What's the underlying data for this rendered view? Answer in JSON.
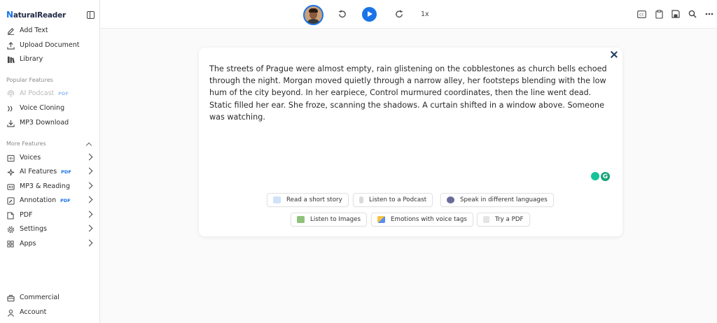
{
  "app": {
    "logo_text": "aturalReader",
    "logo_initial": "N"
  },
  "sidebar": {
    "top_items": [
      {
        "label": "Add Text",
        "icon": "edit-icon"
      },
      {
        "label": "Upload Document",
        "icon": "upload-icon"
      },
      {
        "label": "Library",
        "icon": "library-icon"
      }
    ],
    "popular_label": "Popular Features",
    "popular_items": [
      {
        "label": "AI Podcast",
        "badge": "PDF",
        "icon": "podcast-icon",
        "disabled": true
      },
      {
        "label": "Voice Cloning",
        "icon": "voice-cloning-icon"
      },
      {
        "label": "MP3 Download",
        "icon": "download-icon"
      }
    ],
    "more_label": "More Features",
    "more_items": [
      {
        "label": "Voices",
        "icon": "voices-icon"
      },
      {
        "label": "AI Features",
        "badge": "PDF",
        "icon": "ai-icon"
      },
      {
        "label": "MP3 & Reading",
        "icon": "mp3-reading-icon"
      },
      {
        "label": "Annotation",
        "badge": "PDF",
        "icon": "annotation-icon"
      },
      {
        "label": "PDF",
        "icon": "pdf-icon"
      },
      {
        "label": "Settings",
        "icon": "gear-icon"
      },
      {
        "label": "Apps",
        "icon": "apps-icon"
      }
    ],
    "bottom_items": [
      {
        "label": "Commercial",
        "icon": "briefcase-icon"
      },
      {
        "label": "Account",
        "icon": "user-icon"
      }
    ]
  },
  "toolbar": {
    "speed": "1x",
    "right_icons": [
      "captions-icon",
      "clipboard-icon",
      "save-icon",
      "search-icon",
      "more-icon"
    ]
  },
  "editor": {
    "text": "The streets of Prague were almost empty, rain glistening on the cobblestones as church bells echoed through the night. Morgan moved quietly through a narrow alley, her footsteps blending with the low hum of the city beyond. In her earpiece, Control murmured coordinates, then the line went dead. Static filled her ear. She froze, scanning the shadows. A curtain shifted in a window above. Someone was watching.",
    "suggestions_row1": [
      {
        "label": "Read a short story",
        "icon": "book-icon"
      },
      {
        "label": "Listen to a Podcast",
        "icon": "microphone-icon"
      },
      {
        "label": "Speak in different languages",
        "icon": "speech-icon"
      }
    ],
    "suggestions_row2": [
      {
        "label": "Listen to Images",
        "icon": "image-icon"
      },
      {
        "label": "Emotions with voice tags",
        "icon": "emotions-icon"
      },
      {
        "label": "Try a PDF",
        "icon": "pdf-file-icon"
      }
    ]
  },
  "colors": {
    "accent": "#1a73e8",
    "badge": "#1a73e8",
    "grammarly": "#15c39a"
  }
}
